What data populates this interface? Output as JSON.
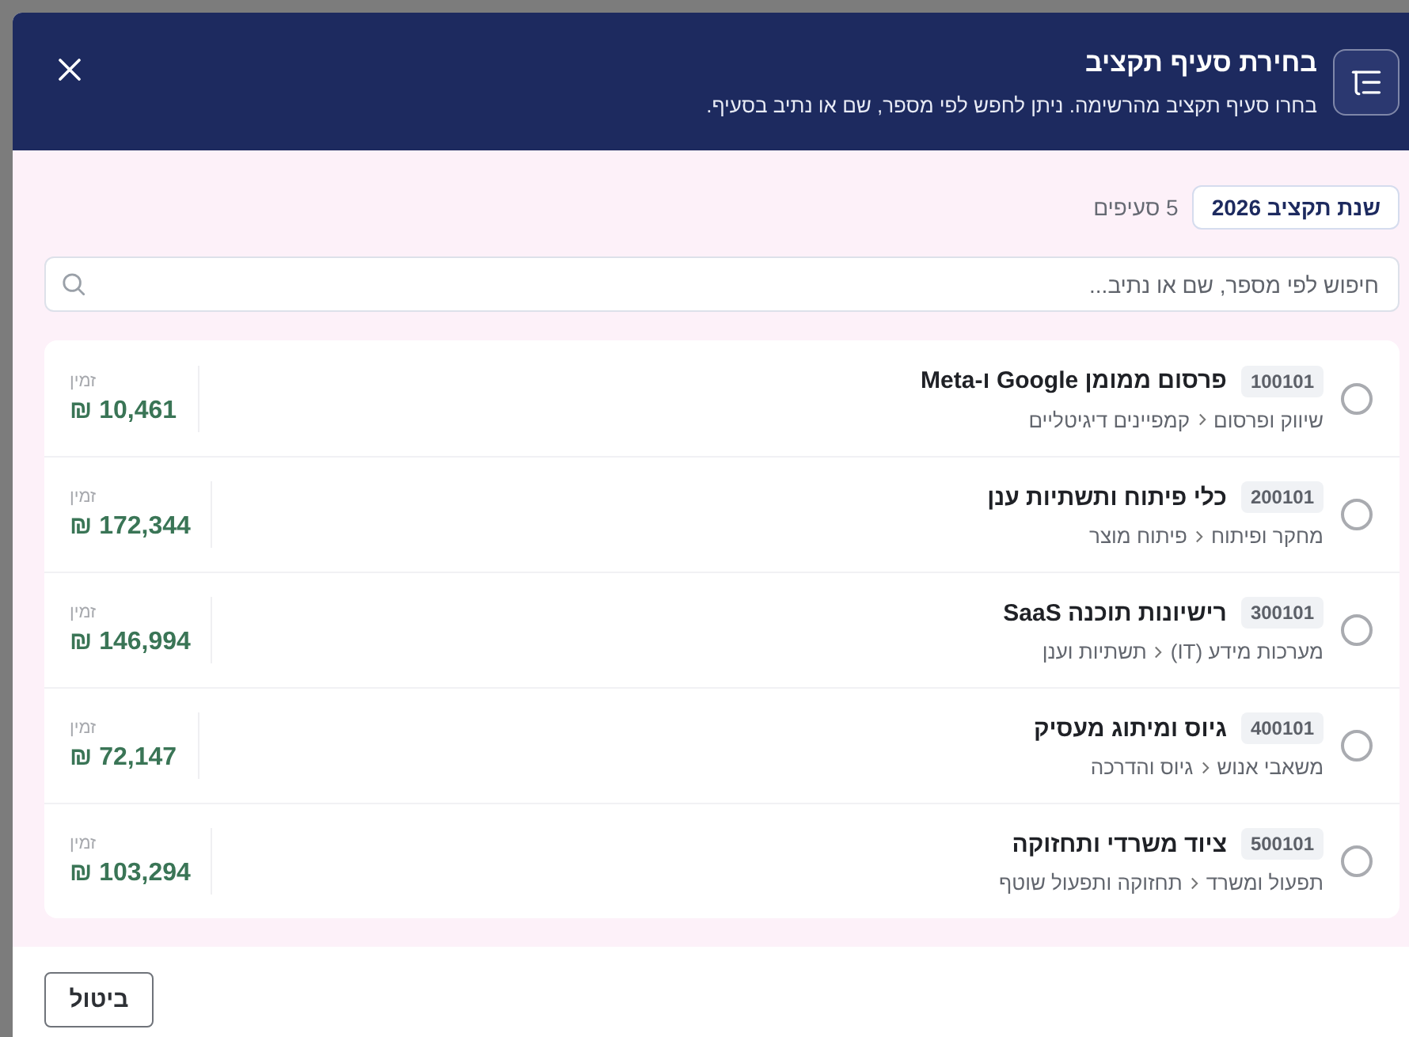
{
  "dialog": {
    "title": "בחירת סעיף תקציב",
    "subtitle": "בחרו סעיף תקציב מהרשימה. ניתן לחפש לפי מספר, שם או נתיב בסעיף."
  },
  "filters": {
    "year_chip": "שנת תקציב 2026",
    "count": "5 סעיפים"
  },
  "search": {
    "placeholder": "חיפוש לפי מספר, שם או נתיב..."
  },
  "items": [
    {
      "code": "100101",
      "name": "פרסום ממומן Google ו-Meta",
      "path": [
        "שיווק ופרסום",
        "קמפיינים דיגיטליים"
      ],
      "amount_label": "זמין",
      "amount": "10,461 ₪",
      "selected": false
    },
    {
      "code": "200101",
      "name": "כלי פיתוח ותשתיות ענן",
      "path": [
        "מחקר ופיתוח",
        "פיתוח מוצר"
      ],
      "amount_label": "זמין",
      "amount": "172,344 ₪",
      "selected": false
    },
    {
      "code": "300101",
      "name": "רישיונות תוכנה SaaS",
      "path": [
        "מערכות מידע (IT)",
        "תשתיות וענן"
      ],
      "amount_label": "זמין",
      "amount": "146,994 ₪",
      "selected": false
    },
    {
      "code": "400101",
      "name": "גיוס ומיתוג מעסיק",
      "path": [
        "משאבי אנוש",
        "גיוס והדרכה"
      ],
      "amount_label": "זמין",
      "amount": "72,147 ₪",
      "selected": false
    },
    {
      "code": "500101",
      "name": "ציוד משרדי ותחזוקה",
      "path": [
        "תפעול ומשרד",
        "תחזוקה ותפעול שוטף"
      ],
      "amount_label": "זמין",
      "amount": "103,294 ₪",
      "selected": false
    }
  ],
  "buttons": [
    {
      "label": "ביטול"
    }
  ]
}
